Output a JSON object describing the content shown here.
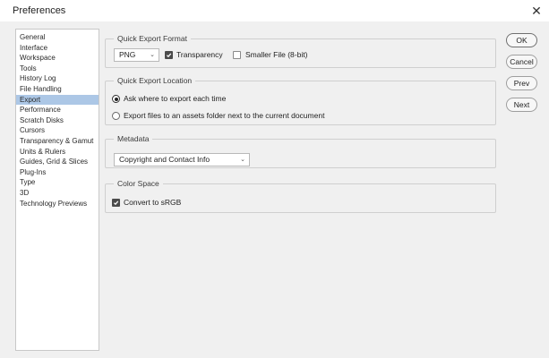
{
  "window": {
    "title": "Preferences",
    "close_glyph": "✕"
  },
  "sidebar": {
    "items": [
      {
        "label": "General"
      },
      {
        "label": "Interface"
      },
      {
        "label": "Workspace"
      },
      {
        "label": "Tools"
      },
      {
        "label": "History Log"
      },
      {
        "label": "File Handling"
      },
      {
        "label": "Export"
      },
      {
        "label": "Performance"
      },
      {
        "label": "Scratch Disks"
      },
      {
        "label": "Cursors"
      },
      {
        "label": "Transparency & Gamut"
      },
      {
        "label": "Units & Rulers"
      },
      {
        "label": "Guides, Grid & Slices"
      },
      {
        "label": "Plug-Ins"
      },
      {
        "label": "Type"
      },
      {
        "label": "3D"
      },
      {
        "label": "Technology Previews"
      }
    ],
    "selected_label": "Export"
  },
  "quick_export_format": {
    "title": "Quick Export Format",
    "format_value": "PNG",
    "transparency_label": "Transparency",
    "transparency_checked": true,
    "smaller_file_label": "Smaller File (8-bit)",
    "smaller_file_checked": false
  },
  "quick_export_location": {
    "title": "Quick Export Location",
    "option_ask_label": "Ask where to export each time",
    "option_assets_label": "Export files to an assets folder next to the current document",
    "selected_option": "ask"
  },
  "metadata": {
    "title": "Metadata",
    "value": "Copyright and Contact Info"
  },
  "color_space": {
    "title": "Color Space",
    "convert_label": "Convert to sRGB",
    "convert_checked": true
  },
  "buttons": {
    "ok": "OK",
    "cancel": "Cancel",
    "prev": "Prev",
    "next": "Next"
  },
  "icons": {
    "chevron": "⌄"
  }
}
